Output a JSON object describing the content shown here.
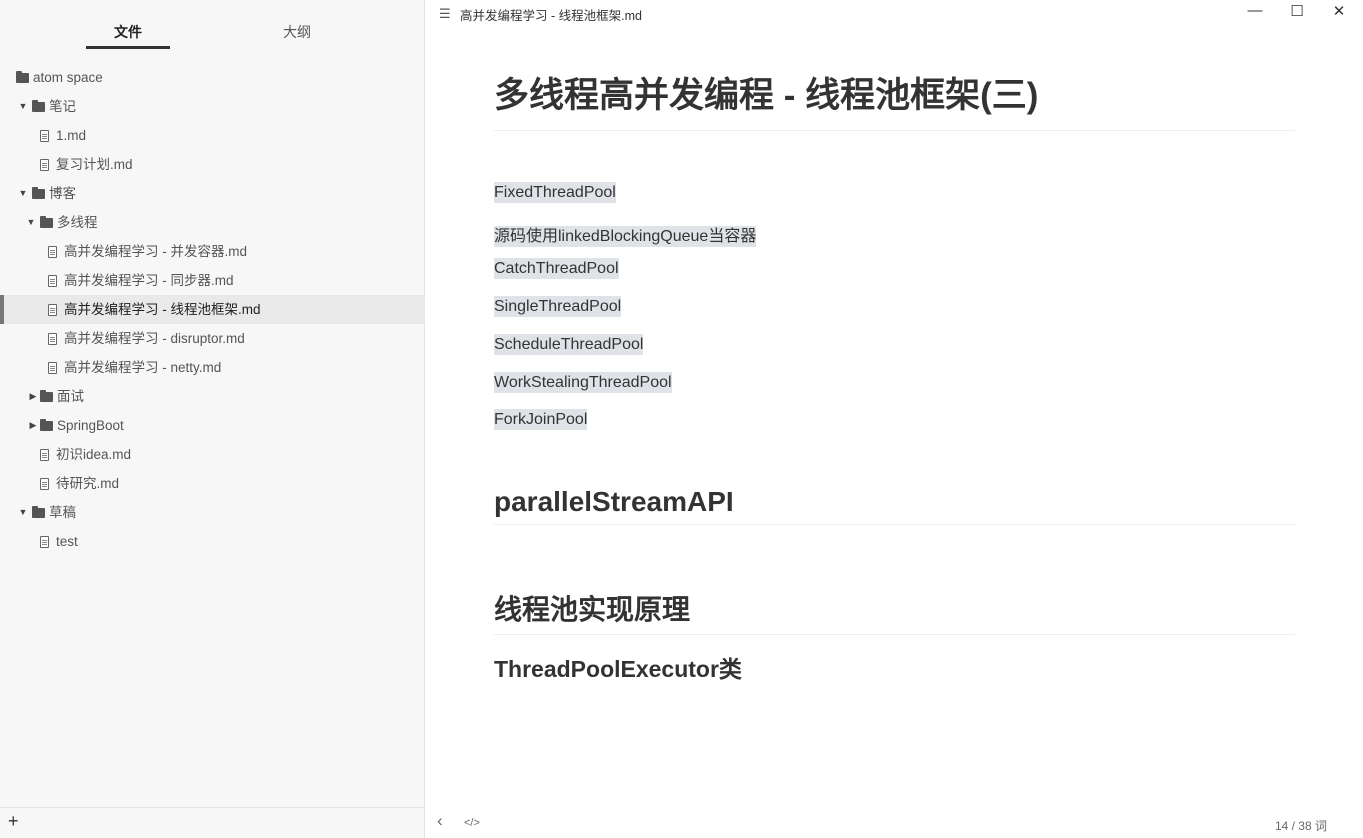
{
  "sidebar": {
    "tabs": [
      {
        "label": "文件"
      },
      {
        "label": "大纲"
      }
    ],
    "tree": [
      {
        "label": "atom space",
        "type": "folder"
      },
      {
        "label": "笔记",
        "type": "folder"
      },
      {
        "label": "1.md",
        "type": "file"
      },
      {
        "label": "复习计划.md",
        "type": "file"
      },
      {
        "label": "博客",
        "type": "folder"
      },
      {
        "label": "多线程",
        "type": "folder"
      },
      {
        "label": "高并发编程学习 - 并发容器.md",
        "type": "file"
      },
      {
        "label": "高并发编程学习 - 同步器.md",
        "type": "file"
      },
      {
        "label": "高并发编程学习 - 线程池框架.md",
        "type": "file"
      },
      {
        "label": "高并发编程学习 - disruptor.md",
        "type": "file"
      },
      {
        "label": "高并发编程学习 - netty.md",
        "type": "file"
      },
      {
        "label": "面试",
        "type": "folder"
      },
      {
        "label": "SpringBoot",
        "type": "folder"
      },
      {
        "label": "初识idea.md",
        "type": "file"
      },
      {
        "label": "待研究.md",
        "type": "file"
      },
      {
        "label": "草稿",
        "type": "folder"
      },
      {
        "label": "test",
        "type": "file"
      }
    ],
    "footer_add": "+"
  },
  "window": {
    "title": "高并发编程学习 - 线程池框架.md",
    "menu_icon": "menu-icon",
    "minimize": "—",
    "maximize": "☐",
    "close": "✕"
  },
  "document": {
    "h1": "多线程高并发编程 - 线程池框架(三)",
    "paragraphs": [
      "FixedThreadPool",
      "源码使用linkedBlockingQueue当容器",
      "CatchThreadPool",
      "SingleThreadPool",
      "ScheduleThreadPool",
      "WorkStealingThreadPool",
      "ForkJoinPool"
    ],
    "h2_1": "parallelStreamAPI",
    "h2_2": "线程池实现原理",
    "h3_1": "ThreadPoolExecutor类"
  },
  "status": {
    "back": "‹",
    "source": "</>",
    "word_count": "14 / 38 词"
  }
}
